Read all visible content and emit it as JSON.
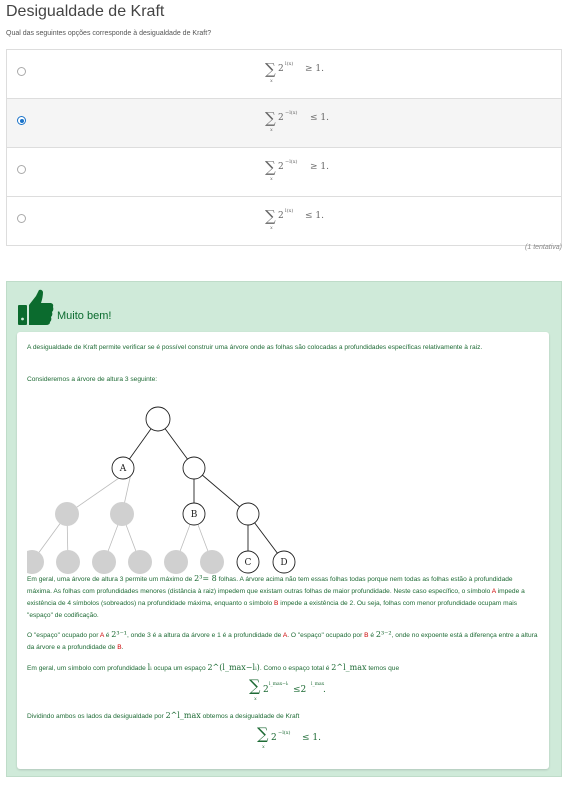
{
  "page": {
    "title": "Desigualdade de Kraft",
    "question": "Qual das seguintes opções corresponde à desigualdade de Kraft?",
    "attempts": "(1 tentativa)"
  },
  "options": [
    {
      "sum_sub": "x",
      "base": "2",
      "exponent": "l(x)",
      "relation": "≥ 1.",
      "selected": false
    },
    {
      "sum_sub": "x",
      "base": "2",
      "exponent": "−l(x)",
      "relation": "≤ 1.",
      "selected": true
    },
    {
      "sum_sub": "x",
      "base": "2",
      "exponent": "−l(x)",
      "relation": "≥ 1.",
      "selected": false
    },
    {
      "sum_sub": "x",
      "base": "2",
      "exponent": "l(x)",
      "relation": "≤ 1.",
      "selected": false
    }
  ],
  "feedback": {
    "title": "Muito bem!",
    "icon": "thumbs-up-icon",
    "colors": {
      "background": "#cfead9",
      "text": "#1e6b35",
      "highlight": "#cc0000"
    },
    "p1": "A desigualdade de Kraft permite verificar se é possível construir uma árvore onde as folhas são colocadas a profundidades específicas relativamente à raiz.",
    "p2": "Consideremos a árvore de altura 3 seguinte:",
    "tree_labels": {
      "A": "A",
      "B": "B",
      "C": "C",
      "D": "D"
    },
    "p3_a": "Em geral, uma árvore de altura 3 permite um máximo de ",
    "p3_math": "2³= 8",
    "p3_b": " folhas. A árvore acima não tem essas folhas todas porque nem todas as folhas estão à profundidade máxima. As folhas com profundidades menores (distância à raiz) impedem que existam outras folhas de maior profundidade. Neste caso específico, o símbolo ",
    "p3_A": "A",
    "p3_c": " impede a existência de 4 símbolos (sobreados) na profundidade máxima, enquanto o símbolo ",
    "p3_B": "B",
    "p3_d": " impede a existência de 2. Ou seja, folhas com menor profundidade ocupam mais \"espaço\" de codificação.",
    "p4_a": "O \"espaço\" ocupado por ",
    "p4_A": "A",
    "p4_b": " é ",
    "p4_m1": "2³⁻¹",
    "p4_c": ", onde 3 é a altura da árvore e 1 é a profundidade de ",
    "p4_A2": "A",
    "p4_d": ". O \"espaço\" ocupado por ",
    "p4_B": "B",
    "p4_e": " é ",
    "p4_m2": "2³⁻²",
    "p4_f": ", onde no expoente está a diferença entre a altura da árvore e a profundidade de ",
    "p4_B2": "B",
    "p4_g": ".",
    "p5_a": "Em geral, um símbolo com profundidade ",
    "p5_m1": "lᵢ",
    "p5_b": " ocupa um espaço ",
    "p5_m2": "2^(l_max−lᵢ)",
    "p5_c": ". Como o espaço total é ",
    "p5_m3": "2^l_max",
    "p5_d": " temos que",
    "eq1": {
      "sub": "x",
      "lhs_exp": "l_max−lᵢ",
      "rel": "≤2",
      "rhs_exp": "l_max",
      "end": "."
    },
    "p6_a": "Dividindo ambos os lados da desigualdade por ",
    "p6_m": "2^l_max",
    "p6_b": " obtemos a desigualdade de Kraft",
    "eq2": {
      "sub": "x",
      "exp": "−l(x)",
      "rel": "≤ 1."
    }
  }
}
